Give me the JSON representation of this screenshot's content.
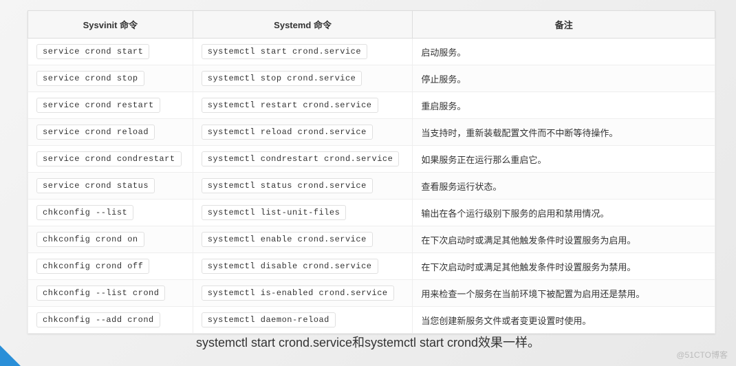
{
  "headers": {
    "col1": "Sysvinit 命令",
    "col2": "Systemd 命令",
    "col3": "备注"
  },
  "rows": [
    {
      "sysv": "service crond start",
      "sysd": "systemctl start crond.service",
      "note": "启动服务。"
    },
    {
      "sysv": "service crond stop",
      "sysd": "systemctl stop crond.service",
      "note": "停止服务。"
    },
    {
      "sysv": "service crond restart",
      "sysd": "systemctl restart crond.service",
      "note": "重启服务。"
    },
    {
      "sysv": "service crond reload",
      "sysd": "systemctl reload crond.service",
      "note": "当支持时，重新装载配置文件而不中断等待操作。"
    },
    {
      "sysv": "service crond condrestart",
      "sysd": "systemctl condrestart crond.service",
      "note": "如果服务正在运行那么重启它。"
    },
    {
      "sysv": "service crond status",
      "sysd": "systemctl status crond.service",
      "note": "查看服务运行状态。"
    },
    {
      "sysv": "chkconfig --list",
      "sysd": "systemctl list-unit-files",
      "note": "输出在各个运行级别下服务的启用和禁用情况。"
    },
    {
      "sysv": "chkconfig crond on",
      "sysd": "systemctl enable crond.service",
      "note": "在下次启动时或满足其他触发条件时设置服务为启用。"
    },
    {
      "sysv": "chkconfig crond off",
      "sysd": "systemctl disable crond.service",
      "note": "在下次启动时或满足其他触发条件时设置服务为禁用。"
    },
    {
      "sysv": "chkconfig --list crond",
      "sysd": "systemctl is-enabled crond.service",
      "note": "用来检查一个服务在当前环境下被配置为启用还是禁用。"
    },
    {
      "sysv": "chkconfig --add crond",
      "sysd": "systemctl daemon-reload",
      "note": "当您创建新服务文件或者变更设置时使用。"
    }
  ],
  "caption": "systemctl start crond.service和systemctl start crond效果一样。",
  "watermark": "@51CTO博客"
}
